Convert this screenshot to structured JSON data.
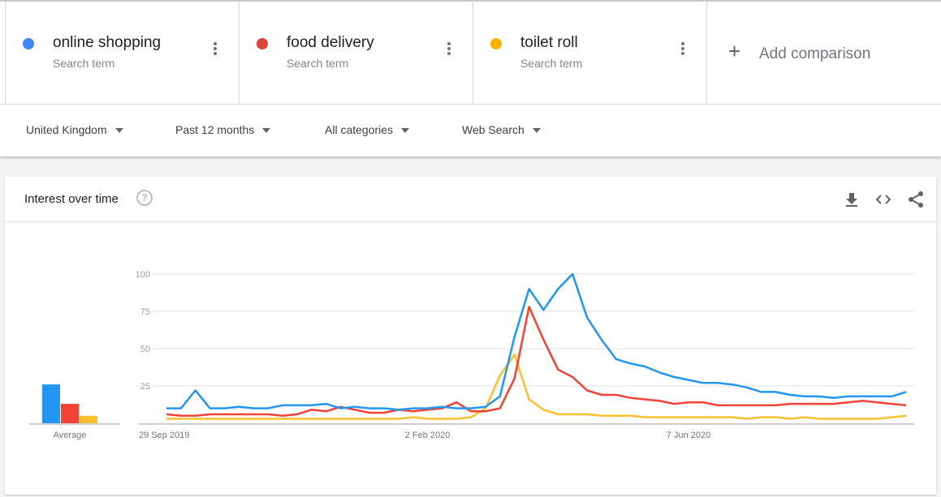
{
  "comparison": {
    "terms": [
      {
        "name": "online shopping",
        "subtitle": "Search term",
        "color": "#4285f4"
      },
      {
        "name": "food delivery",
        "subtitle": "Search term",
        "color": "#db4437"
      },
      {
        "name": "toilet roll",
        "subtitle": "Search term",
        "color": "#f4b400"
      }
    ],
    "add_label": "Add comparison",
    "add_icon": "plus-icon"
  },
  "filters": {
    "region": "United Kingdom",
    "time_range": "Past 12 months",
    "category": "All categories",
    "search_type": "Web Search"
  },
  "card": {
    "title": "Interest over time",
    "help_icon": "?",
    "actions": [
      "download-icon",
      "embed-code-icon",
      "share-icon"
    ]
  },
  "chart_data": {
    "type": "line",
    "title": "Interest over time",
    "xlabel": "",
    "ylabel": "",
    "ylim": [
      0,
      100
    ],
    "yticks": [
      25,
      50,
      75,
      100
    ],
    "xtick_labels": [
      {
        "index": 0,
        "label": "29 Sep 2019"
      },
      {
        "index": 18,
        "label": "2 Feb 2020"
      },
      {
        "index": 36,
        "label": "7 Jun 2020"
      }
    ],
    "grid": true,
    "n_points": 52,
    "series": [
      {
        "name": "online shopping",
        "color": "#2196f3",
        "values": [
          10,
          10,
          22,
          10,
          10,
          11,
          10,
          10,
          12,
          12,
          12,
          13,
          10,
          11,
          10,
          10,
          9,
          10,
          10,
          11,
          10,
          10,
          11,
          18,
          58,
          90,
          76,
          90,
          100,
          71,
          56,
          43,
          40,
          38,
          34,
          31,
          29,
          27,
          27,
          26,
          24,
          21,
          21,
          19,
          18,
          18,
          17,
          18,
          18,
          18,
          18,
          21
        ]
      },
      {
        "name": "food delivery",
        "color": "#f44336",
        "values": [
          6,
          5,
          5,
          6,
          6,
          6,
          6,
          6,
          5,
          6,
          9,
          8,
          11,
          9,
          7,
          7,
          9,
          8,
          9,
          10,
          14,
          8,
          8,
          10,
          30,
          78,
          56,
          36,
          31,
          22,
          19,
          19,
          17,
          16,
          15,
          13,
          14,
          14,
          12,
          12,
          12,
          12,
          12,
          13,
          13,
          13,
          13,
          14,
          15,
          14,
          13,
          12
        ]
      },
      {
        "name": "toilet roll",
        "color": "#fbc02d",
        "values": [
          3,
          3,
          3,
          3,
          3,
          3,
          3,
          3,
          3,
          3,
          3,
          3,
          3,
          3,
          3,
          3,
          3,
          4,
          3,
          3,
          3,
          4,
          10,
          32,
          46,
          16,
          9,
          6,
          6,
          6,
          5,
          5,
          5,
          4,
          4,
          4,
          4,
          4,
          4,
          4,
          3,
          4,
          4,
          3,
          4,
          3,
          3,
          3,
          3,
          3,
          4,
          5
        ]
      }
    ],
    "average": {
      "label": "Average",
      "values": [
        26,
        13,
        5
      ]
    }
  }
}
